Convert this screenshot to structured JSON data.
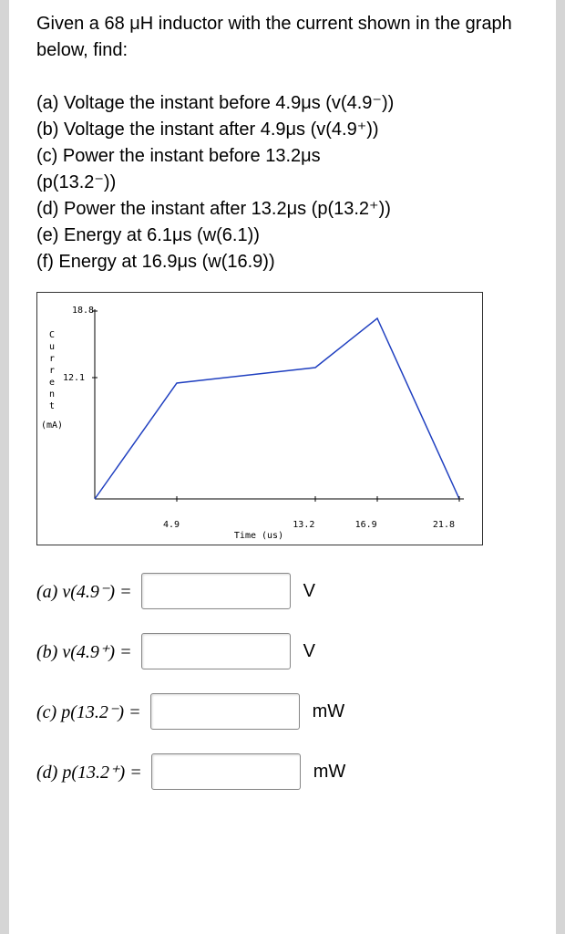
{
  "problem": {
    "intro": "Given a 68 μH inductor with the current shown in the graph below, find:",
    "parts": {
      "a": "(a) Voltage the instant before 4.9μs (v(4.9⁻))",
      "b": "(b) Voltage the instant after 4.9μs (v(4.9⁺))",
      "c1": "(c) Power the instant before 13.2μs",
      "c2": "(p(13.2⁻))",
      "d": "(d) Power the instant after 13.2μs (p(13.2⁺))",
      "e": "(e) Energy at 6.1μs (w(6.1))",
      "f": "(f) Energy at 16.9μs (w(16.9))"
    }
  },
  "chart_data": {
    "type": "line",
    "title": "",
    "xlabel": "Time (us)",
    "ylabel": "Current (mA)",
    "x_ticks": [
      "4.9",
      "13.2",
      "16.9",
      "21.8"
    ],
    "y_ticks": [
      "18.8",
      "12.1"
    ],
    "xlim": [
      0,
      21.8
    ],
    "ylim": [
      0,
      20
    ],
    "series": [
      {
        "name": "current",
        "x": [
          0,
          4.9,
          13.2,
          16.9,
          21.8
        ],
        "y": [
          0,
          12.1,
          13.7,
          18.8,
          0
        ]
      }
    ]
  },
  "answers": {
    "a": {
      "label": "(a) v(4.9⁻) = ",
      "unit": "V"
    },
    "b": {
      "label": "(b) v(4.9⁺) = ",
      "unit": "V"
    },
    "c": {
      "label": "(c) p(13.2⁻) = ",
      "unit": "mW"
    },
    "d": {
      "label": "(d) p(13.2⁺) = ",
      "unit": "mW"
    }
  }
}
